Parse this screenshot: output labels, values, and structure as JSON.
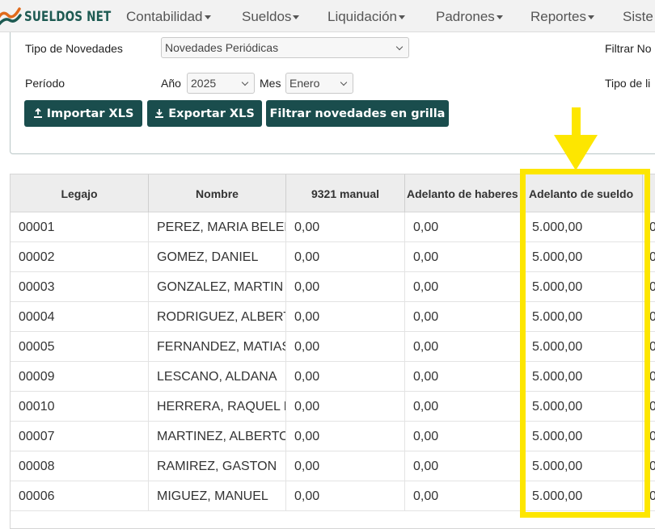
{
  "navbar": {
    "brand": "SUELDOS NET",
    "menu": [
      {
        "label": "Contabilidad"
      },
      {
        "label": "Sueldos"
      },
      {
        "label": "Liquidación"
      },
      {
        "label": "Padrones"
      },
      {
        "label": "Reportes"
      },
      {
        "label": "Siste"
      }
    ]
  },
  "filters": {
    "tipo_label": "Tipo de Novedades",
    "tipo_value": "Novedades Periódicas",
    "filtrar_label": "Filtrar No",
    "periodo_label": "Período",
    "anio_label": "Año",
    "anio_value": "2025",
    "mes_label": "Mes",
    "mes_value": "Enero",
    "tipo_li_label": "Tipo de li"
  },
  "buttons": {
    "importar": "Importar XLS",
    "exportar": "Exportar XLS",
    "filtrar": "Filtrar novedades en grilla"
  },
  "grid": {
    "headers": [
      "Legajo",
      "Nombre",
      "9321 manual",
      "Adelanto de haberes",
      "Adelanto de sueldo"
    ],
    "rows": [
      {
        "legajo": "00001",
        "nombre": "PEREZ, MARIA BELEN",
        "manual": "0,00",
        "haberes": "0,00",
        "sueldo": "5.000,00",
        "extra": "0"
      },
      {
        "legajo": "00002",
        "nombre": "GOMEZ, DANIEL",
        "manual": "0,00",
        "haberes": "0,00",
        "sueldo": "5.000,00",
        "extra": "0"
      },
      {
        "legajo": "00003",
        "nombre": "GONZALEZ, MARTIN",
        "manual": "0,00",
        "haberes": "0,00",
        "sueldo": "5.000,00",
        "extra": "0"
      },
      {
        "legajo": "00004",
        "nombre": "RODRIGUEZ, ALBERTO",
        "manual": "0,00",
        "haberes": "0,00",
        "sueldo": "5.000,00",
        "extra": "0"
      },
      {
        "legajo": "00005",
        "nombre": "FERNANDEZ, MATIAS",
        "manual": "0,00",
        "haberes": "0,00",
        "sueldo": "5.000,00",
        "extra": "0"
      },
      {
        "legajo": "00009",
        "nombre": "LESCANO, ALDANA",
        "manual": "0,00",
        "haberes": "0,00",
        "sueldo": "5.000,00",
        "extra": "0"
      },
      {
        "legajo": "00010",
        "nombre": "HERRERA, RAQUEL E",
        "manual": "0,00",
        "haberes": "0,00",
        "sueldo": "5.000,00",
        "extra": "0"
      },
      {
        "legajo": "00007",
        "nombre": "MARTINEZ, ALBERTO",
        "manual": "0,00",
        "haberes": "0,00",
        "sueldo": "5.000,00",
        "extra": "0"
      },
      {
        "legajo": "00008",
        "nombre": "RAMIREZ, GASTON",
        "manual": "0,00",
        "haberes": "0,00",
        "sueldo": "5.000,00",
        "extra": "0"
      },
      {
        "legajo": "00006",
        "nombre": "MIGUEZ, MANUEL",
        "manual": "0,00",
        "haberes": "0,00",
        "sueldo": "5.000,00",
        "extra": "0"
      }
    ]
  },
  "icons": {
    "brand_logo": "sueldos-net-logo-icon",
    "import_icon": "import-upload-icon",
    "export_icon": "export-download-icon",
    "select_arrow": "chevron-down-icon",
    "highlight_arrow": "arrow-down-icon"
  },
  "colors": {
    "brand": "#1d5a52",
    "button": "#1a4d4d",
    "highlight": "#fde600",
    "navbar_bg": "#f2f2f2",
    "header_bg": "#ededed"
  }
}
